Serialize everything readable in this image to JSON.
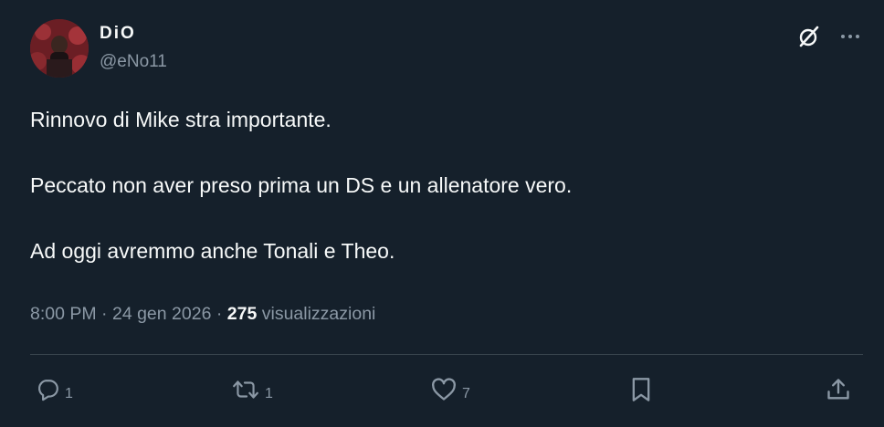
{
  "author": {
    "display_name": "DiO",
    "handle": "@eNo11"
  },
  "tweet": {
    "paragraphs": [
      "Rinnovo di Mike stra importante.",
      "Peccato non aver preso prima un DS e un allenatore vero.",
      "Ad oggi avremmo anche Tonali e Theo."
    ],
    "time": "8:00 PM",
    "separator": "·",
    "date": "24 gen 2026",
    "views_count": "275",
    "views_label": "visualizzazioni"
  },
  "actions": {
    "reply_count": "1",
    "retweet_count": "1",
    "like_count": "7"
  },
  "icons": {
    "grok": "grok-icon",
    "more": "more-icon",
    "reply": "reply-icon",
    "retweet": "retweet-icon",
    "like": "heart-icon",
    "bookmark": "bookmark-icon",
    "share": "share-icon"
  },
  "colors": {
    "background": "#15202b",
    "primary_text": "#f7f9f9",
    "secondary_text": "#8b98a5",
    "divider": "#38444d"
  }
}
